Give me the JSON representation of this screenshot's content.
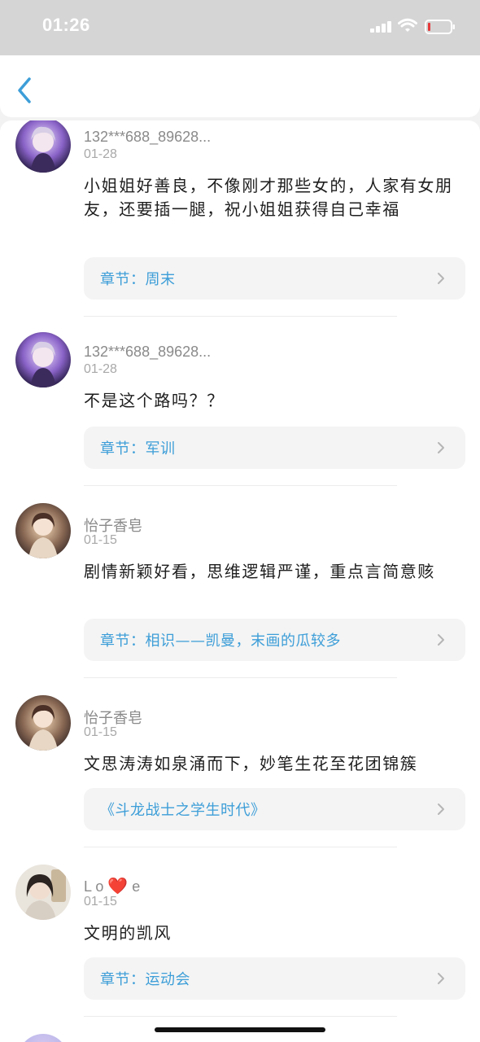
{
  "status_bar": {
    "time": "01:26"
  },
  "nav": {
    "back_icon": "chevron-left-icon"
  },
  "colors": {
    "accent": "#3d9ed8",
    "heart": "#e0342f"
  },
  "comments": [
    {
      "username": "132***688_89628...",
      "date": "01-28",
      "text": "小姐姐好善良，不像刚才那些女的，人家有女朋友，还要插一腿，祝小姐姐获得自己幸福",
      "chapter": "章节：周末"
    },
    {
      "username": "132***688_89628...",
      "date": "01-28",
      "text": "不是这个路吗？？",
      "chapter": "章节：军训"
    },
    {
      "username": "怡子香皂",
      "date": "01-15",
      "text": "剧情新颖好看，思维逻辑严谨，重点言简意赅",
      "chapter": "章节：相识——凯曼，末画的瓜较多"
    },
    {
      "username": "怡子香皂",
      "date": "01-15",
      "text": "文思涛涛如泉涌而下，妙笔生花至花团锦簇",
      "chapter": "《斗龙战士之学生时代》"
    },
    {
      "username_prefix": "L o ",
      "username_heart": "❤️",
      "username_suffix": " e",
      "date": "01-15",
      "text": "文明的凯风",
      "chapter": "章节：运动会"
    }
  ]
}
